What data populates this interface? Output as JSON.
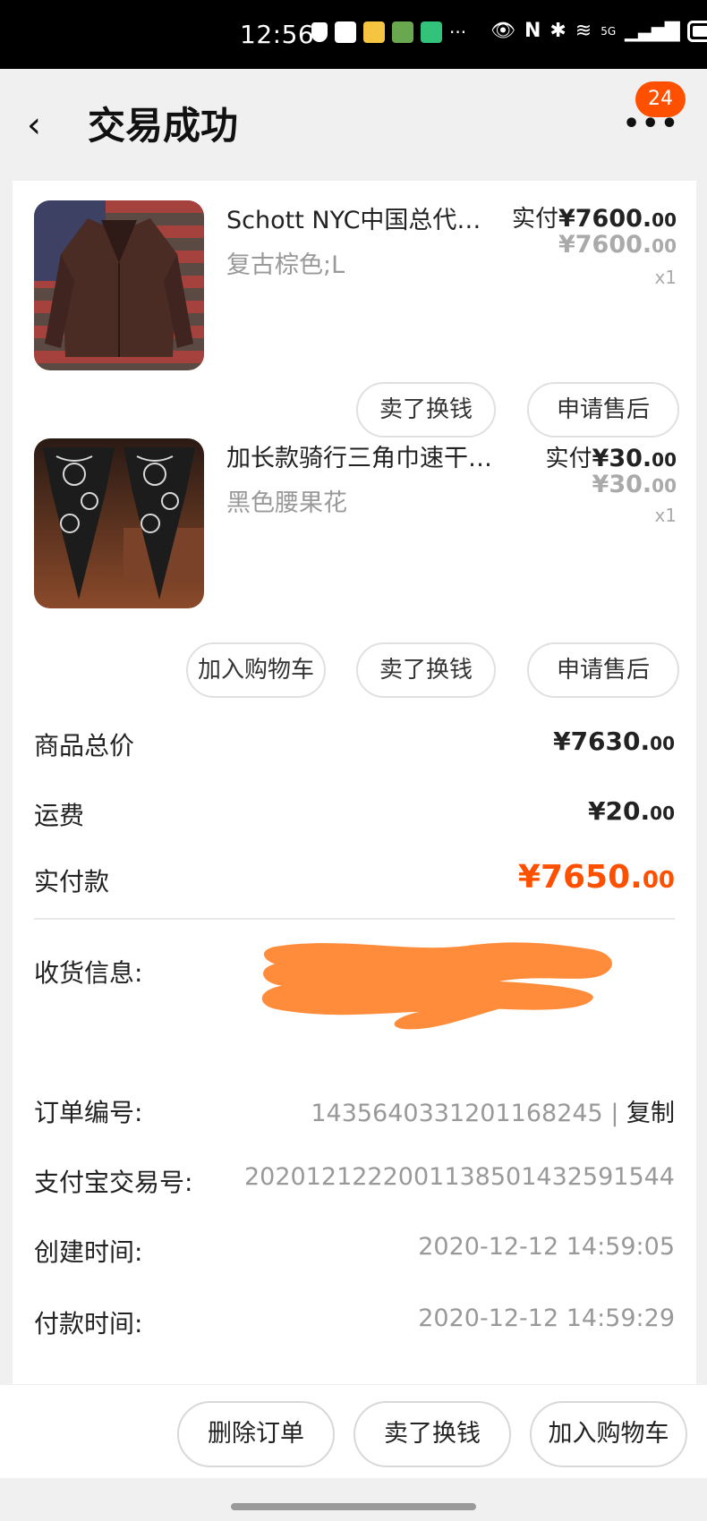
{
  "status_bar": {
    "time": "12:56",
    "network": "5G",
    "more": "···"
  },
  "header": {
    "back_icon": "‹",
    "title": "交易成功",
    "more_icon": "•••",
    "badge_count": "24"
  },
  "products": [
    {
      "name": "Schott NYC中国总代…",
      "spec": "复古棕色;L",
      "pay_label": "实付",
      "pay_int": "¥7600.",
      "pay_dec": "00",
      "orig_int": "¥7600.",
      "orig_dec": "00",
      "qty": "x1",
      "actions": [
        "卖了换钱",
        "申请售后"
      ],
      "image_icon": "leather-jacket-image"
    },
    {
      "name": "加长款骑行三角巾速干…",
      "spec": "黑色腰果花",
      "pay_label": "实付",
      "pay_int": "¥30.",
      "pay_dec": "00",
      "orig_int": "¥30.",
      "orig_dec": "00",
      "qty": "x1",
      "actions": [
        "加入购物车",
        "卖了换钱",
        "申请售后"
      ],
      "image_icon": "paisley-bandana-image"
    }
  ],
  "summary": {
    "goods_total_label": "商品总价",
    "goods_total_int": "¥7630.",
    "goods_total_dec": "00",
    "shipping_label": "运费",
    "shipping_int": "¥20.",
    "shipping_dec": "00",
    "paid_label": "实付款",
    "paid_int": "¥7650.",
    "paid_dec": "00"
  },
  "info": {
    "address_label": "收货信息:",
    "order_no_label": "订单编号:",
    "order_no": "1435640331201168245",
    "copy_label": "复制",
    "alipay_label": "支付宝交易号:",
    "alipay_no": "2020121222001138501432591544",
    "created_label": "创建时间:",
    "created_time": "2020-12-12 14:59:05",
    "paid_time_label": "付款时间:",
    "paid_time": "2020-12-12 14:59:29"
  },
  "bottom_bar": {
    "delete_label": "删除订单",
    "sell_label": "卖了换钱",
    "add_cart_label": "加入购物车"
  },
  "colors": {
    "accent": "#ff5000",
    "redaction": "#ff8c3a"
  }
}
